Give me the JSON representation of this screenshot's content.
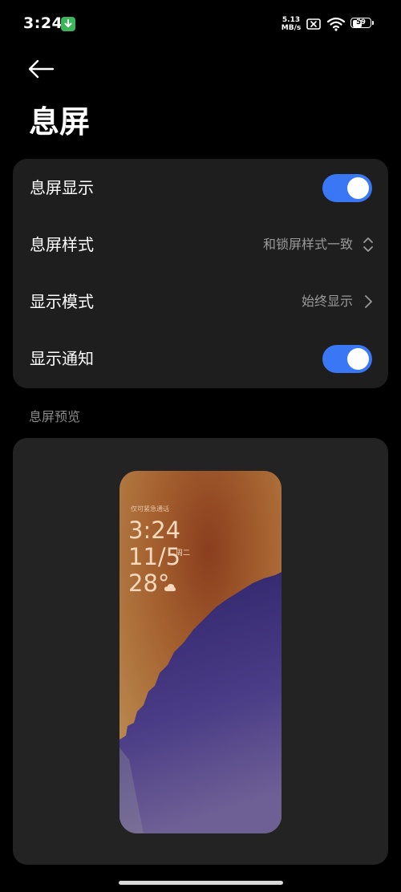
{
  "status_bar": {
    "time": "3:24",
    "net_speed_value": "5.13",
    "net_speed_unit": "MB/s",
    "battery_level": "59",
    "battery_fraction": 0.59
  },
  "header": {
    "title": "息屏"
  },
  "settings": {
    "aod_display": {
      "label": "息屏显示",
      "enabled": true
    },
    "aod_style": {
      "label": "息屏样式",
      "value": "和锁屏样式一致"
    },
    "display_mode": {
      "label": "显示模式",
      "value": "始终显示"
    },
    "show_notifications": {
      "label": "显示通知",
      "enabled": true
    }
  },
  "preview": {
    "section_title": "息屏预览",
    "emergency_text": "仅可紧急通话",
    "time": "3:24",
    "date": "11/5",
    "weekday": "周二",
    "temperature": "28°",
    "weather_icon": "cloud-icon"
  },
  "colors": {
    "toggle_on": "#3a77f5",
    "card_bg": "#1e1e1e",
    "preview_bg": "#232323"
  }
}
